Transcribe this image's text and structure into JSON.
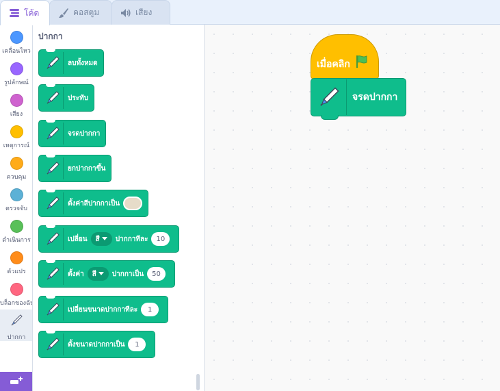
{
  "tabs": [
    {
      "label": "โค้ด",
      "icon": "code-icon",
      "active": true
    },
    {
      "label": "คอสตูม",
      "icon": "brush-icon",
      "active": false
    },
    {
      "label": "เสียง",
      "icon": "speaker-icon",
      "active": false
    }
  ],
  "categories": [
    {
      "label": "เคลื่อนไหว",
      "color": "#4c97ff"
    },
    {
      "label": "รูปลักษณ์",
      "color": "#9966ff"
    },
    {
      "label": "เสียง",
      "color": "#cf63cf"
    },
    {
      "label": "เหตุการณ์",
      "color": "#ffbf00"
    },
    {
      "label": "ควบคุม",
      "color": "#ffab19"
    },
    {
      "label": "ตรวจจับ",
      "color": "#5cb1d6"
    },
    {
      "label": "ดำเนินการ",
      "color": "#59c059"
    },
    {
      "label": "ตัวแปร",
      "color": "#ff8c1a"
    },
    {
      "label": "บล็อกของฉัน",
      "color": "#ff6680"
    },
    {
      "label": "ปากกา",
      "icon": "pen-icon"
    }
  ],
  "palette": {
    "title": "ปากกา",
    "blocks": [
      {
        "text": "ลบทั้งหมด"
      },
      {
        "text": "ประทับ"
      },
      {
        "text": "จรดปากกา"
      },
      {
        "text": "ยกปากกาขึ้น"
      },
      {
        "text": "ตั้งค่าสีปากกาเป็น"
      },
      {
        "text": "เปลี่ยน",
        "dropdown": "สี",
        "text2": "ปากกาทีละ",
        "value": "10"
      },
      {
        "text": "ตั้งค่า",
        "dropdown": "สี",
        "text2": "ปากกาเป็น",
        "value": "50"
      },
      {
        "text": "เปลี่ยนขนาดปากกาทีละ",
        "value": "1"
      },
      {
        "text": "ตั้งขนาดปากกาเป็น",
        "value": "1"
      }
    ]
  },
  "script": {
    "hat_label": "เมื่อคลิก",
    "block_label": "จรดปากกา"
  },
  "colors": {
    "pen_block": "#0fbd8c",
    "event_block": "#ffbf00",
    "accent": "#855cd6"
  }
}
